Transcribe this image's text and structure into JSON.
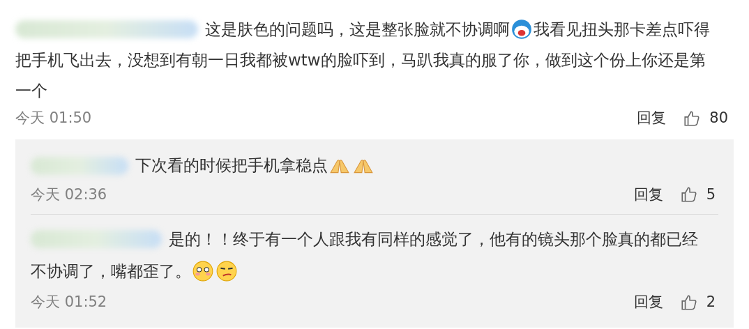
{
  "comment": {
    "lines": [
      [
        {
          "kind": "text",
          "text": "这是肤色的问题吗，这是整张脸就不协调啊"
        },
        {
          "kind": "face"
        },
        {
          "kind": "text",
          "text": "我看见扭头那卡差点吓得"
        }
      ],
      [
        {
          "kind": "text",
          "text": "把手机飞出去，没想到有朝一日我都被wtw的脸吓到，马趴我真的服了你，做到这个份上你还是第"
        }
      ],
      [
        {
          "kind": "text",
          "text": "一个"
        }
      ]
    ],
    "time": "今天 01:50",
    "reply": "回复",
    "likes": "80"
  },
  "replies": [
    {
      "lines": [
        [
          {
            "kind": "text",
            "text": "下次看的时候把手机拿稳点"
          },
          {
            "kind": "hands"
          },
          {
            "kind": "hands"
          }
        ]
      ],
      "time": "今天 02:36",
      "reply": "回复",
      "likes": "5"
    },
    {
      "lines": [
        [
          {
            "kind": "text",
            "text": "是的！！终于有一个人跟我有同样的感觉了，他有的镜头那个脸真的都已经"
          }
        ],
        [
          {
            "kind": "text",
            "text": "不协调了，嘴都歪了。"
          },
          {
            "kind": "blush"
          },
          {
            "kind": "smirk"
          }
        ]
      ],
      "time": "今天 01:52",
      "reply": "回复",
      "likes": "2"
    }
  ]
}
